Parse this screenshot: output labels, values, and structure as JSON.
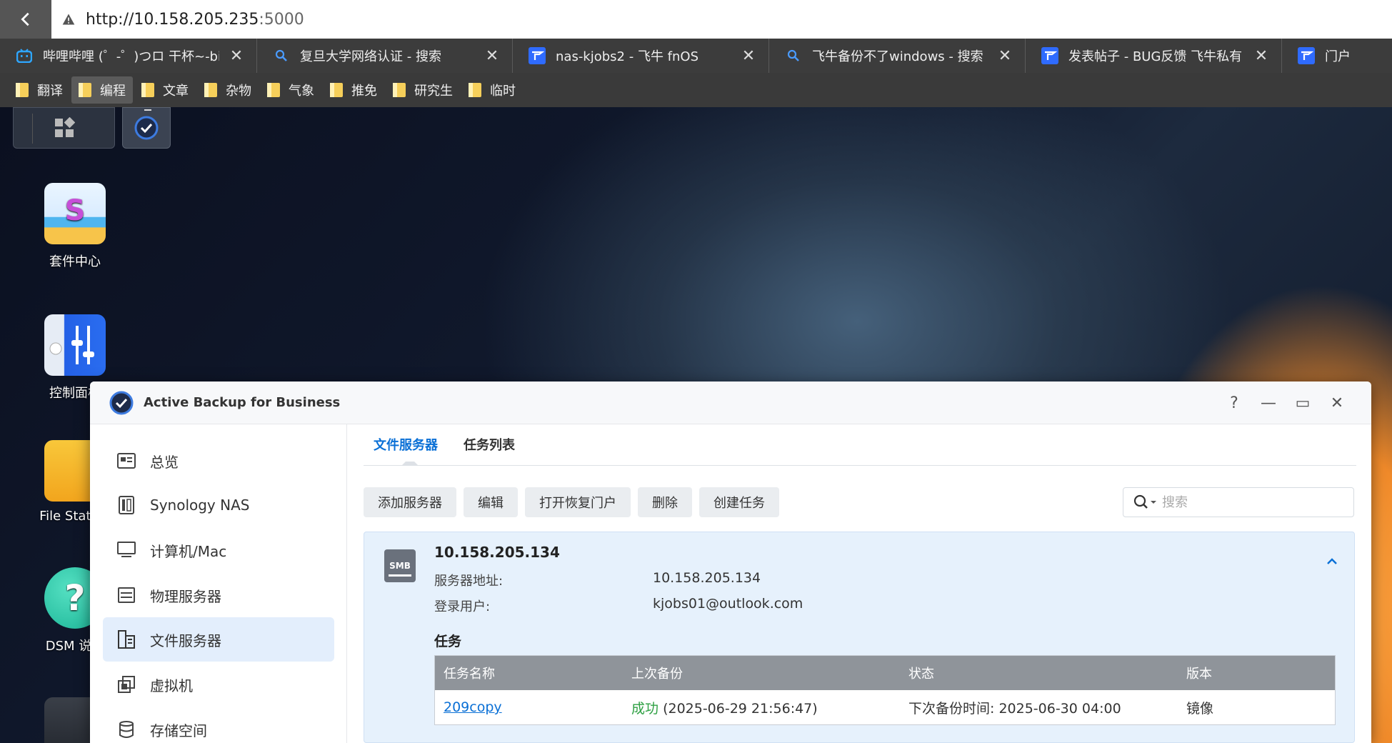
{
  "browser": {
    "url_host": "http://10.158.205.235",
    "url_port": ":5000",
    "tabs": [
      {
        "label": "哔哩哔哩 (゜-゜)つロ 干杯~-bi",
        "icon": "bilibili-icon"
      },
      {
        "label": "复旦大学网络认证 - 搜索",
        "icon": "search-icon"
      },
      {
        "label": "nas-kjobs2 - 飞牛 fnOS",
        "icon": "fnos-icon"
      },
      {
        "label": "飞牛备份不了windows - 搜索",
        "icon": "search-icon"
      },
      {
        "label": "发表帖子 - BUG反馈 飞牛私有",
        "icon": "fnos-icon"
      },
      {
        "label": "门户",
        "icon": "fnos-icon"
      }
    ],
    "bookmarks": [
      "翻译",
      "编程",
      "文章",
      "杂物",
      "气象",
      "推免",
      "研究生",
      "临时"
    ],
    "active_bookmark": 1
  },
  "desktop": {
    "icons": [
      {
        "label": "套件中心",
        "icon": "package-center-icon"
      },
      {
        "label": "控制面板",
        "icon": "control-panel-icon"
      },
      {
        "label": "File Station",
        "icon": "file-station-icon"
      },
      {
        "label": "DSM 说明",
        "icon": "dsm-help-icon"
      },
      {
        "label": "",
        "icon": "storage-icon"
      }
    ]
  },
  "window": {
    "title": "Active Backup for Business",
    "controls": [
      "?",
      "—",
      "▭",
      "✕"
    ],
    "sidebar": [
      {
        "label": "总览",
        "icon": "overview-icon"
      },
      {
        "label": "Synology NAS",
        "icon": "nas-icon"
      },
      {
        "label": "计算机/Mac",
        "icon": "computer-icon"
      },
      {
        "label": "物理服务器",
        "icon": "physical-server-icon"
      },
      {
        "label": "文件服务器",
        "icon": "file-server-icon"
      },
      {
        "label": "虚拟机",
        "icon": "virtual-machine-icon"
      },
      {
        "label": "存储空间",
        "icon": "storage-icon"
      }
    ],
    "sidebar_active": 4,
    "tabs": [
      "文件服务器",
      "任务列表"
    ],
    "active_tab": 0,
    "toolbar": [
      "添加服务器",
      "编辑",
      "打开恢复门户",
      "删除",
      "创建任务"
    ],
    "search_placeholder": "搜索",
    "server": {
      "badge": "SMB",
      "name": "10.158.205.134",
      "address_label": "服务器地址:",
      "address": "10.158.205.134",
      "user_label": "登录用户:",
      "user": "kjobs01@outlook.com",
      "tasks_heading": "任务",
      "columns": [
        "任务名称",
        "上次备份",
        "状态",
        "版本"
      ],
      "rows": [
        {
          "name": "209copy",
          "last_status": "成功",
          "last_time": "(2025-06-29 21:56:47)",
          "next_backup": "下次备份时间:  2025-06-30 04:00",
          "version": "镜像"
        }
      ]
    }
  },
  "colors": {
    "accent": "#0a70d6",
    "success": "#2ea043",
    "active_nav": "#e3eefc"
  }
}
